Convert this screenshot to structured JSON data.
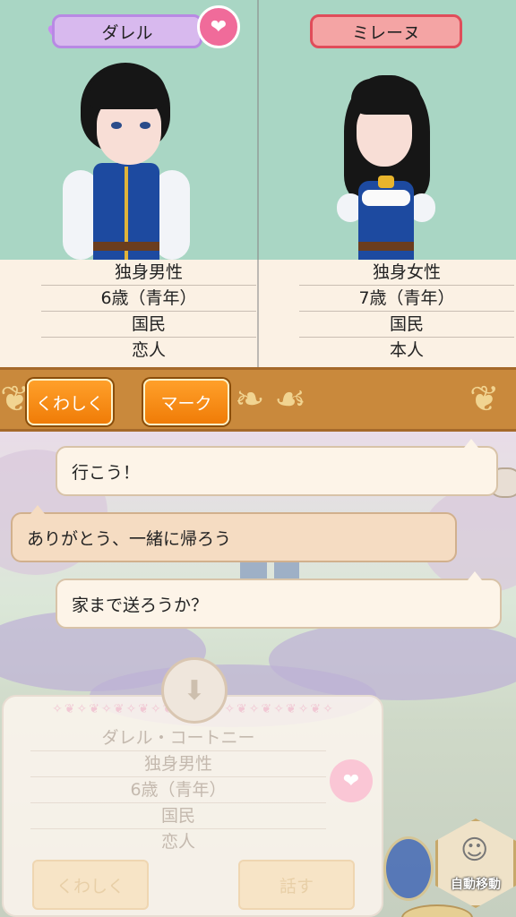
{
  "left_character": {
    "name": "ダレル",
    "info": [
      "独身男性",
      "6歳（青年）",
      "国民",
      "恋人"
    ]
  },
  "right_character": {
    "name": "ミレーヌ",
    "info": [
      "独身女性",
      "7歳（青年）",
      "国民",
      "本人"
    ]
  },
  "toolbar": {
    "details_label": "くわしく",
    "mark_label": "マーク"
  },
  "dialogue": [
    {
      "text": "行こう！",
      "speaker": "other"
    },
    {
      "text": "ありがとう、一緒に帰ろう",
      "speaker": "self"
    },
    {
      "text": "家まで送ろうか？",
      "speaker": "other"
    }
  ],
  "target_card": {
    "name": "ダレル・コートニー",
    "info": [
      "独身男性",
      "6歳（青年）",
      "国民",
      "恋人"
    ],
    "details_label": "くわしく",
    "talk_label": "話す"
  },
  "auto_move_label": "自動移動",
  "colors": {
    "left_plate": "#d8b9ee",
    "right_plate": "#f4a4a4",
    "accent_orange": "#f07c07",
    "heart_pink": "#f06b9a"
  }
}
